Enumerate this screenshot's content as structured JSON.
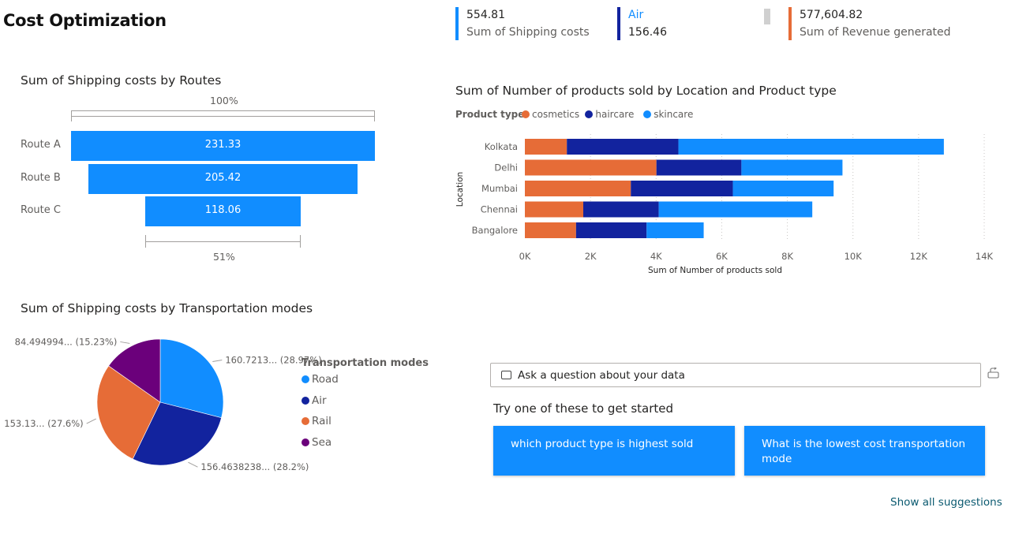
{
  "page": {
    "title": "Cost Optimization"
  },
  "kpis": [
    {
      "value": "554.81",
      "label": "Sum of Shipping costs",
      "color": "#118dff"
    },
    {
      "value": "156.46",
      "label": "Air",
      "color": "#12239e",
      "label_color": "#118dff"
    },
    {
      "value": "577,604.82",
      "label": "Sum of Revenue generated",
      "color": "#e66c37"
    }
  ],
  "funnel": {
    "title": "Sum of Shipping costs by Routes",
    "top_pct": "100%",
    "bottom_pct": "51%",
    "color": "#118dff",
    "chart_data": {
      "type": "bar",
      "categories": [
        "Route A",
        "Route B",
        "Route C"
      ],
      "values": [
        231.33,
        205.42,
        118.06
      ],
      "value_labels": [
        "231.33",
        "205.42",
        "118.06"
      ]
    }
  },
  "stacked": {
    "title": "Sum of Number of products sold by Location and Product type",
    "legend_title": "Product type",
    "xlabel": "Sum of Number of products sold",
    "ylabel": "Location",
    "chart_data": {
      "type": "bar",
      "orientation": "horizontal-stacked",
      "categories": [
        "Kolkata",
        "Delhi",
        "Mumbai",
        "Chennai",
        "Bangalore"
      ],
      "series": [
        {
          "name": "cosmetics",
          "color": "#e66c37",
          "values": [
            1280,
            4010,
            3230,
            1780,
            1560
          ]
        },
        {
          "name": "haircare",
          "color": "#12239e",
          "values": [
            3400,
            2590,
            3110,
            2300,
            2150
          ]
        },
        {
          "name": "skincare",
          "color": "#118dff",
          "values": [
            8090,
            3080,
            3070,
            4680,
            1740
          ]
        }
      ],
      "xlim": [
        0,
        14000
      ],
      "xticks": [
        "0K",
        "2K",
        "4K",
        "6K",
        "8K",
        "10K",
        "12K",
        "14K"
      ],
      "grid": true,
      "legend": "top-left"
    }
  },
  "pie": {
    "title": "Sum of Shipping costs by Transportation modes",
    "legend_title": "Transportation modes",
    "chart_data": {
      "type": "pie",
      "categories": [
        "Road",
        "Air",
        "Rail",
        "Sea"
      ],
      "values": [
        160.7213,
        156.4638238,
        153.13,
        84.494994
      ],
      "percentages": [
        28.97,
        28.2,
        27.6,
        15.23
      ],
      "labels": [
        "160.7213... (28.97%)",
        "156.4638238... (28.2%)",
        "153.13... (27.6%)",
        "84.494994... (15.23%)"
      ],
      "colors": [
        "#118dff",
        "#12239e",
        "#e66c37",
        "#6b007b"
      ],
      "legend": "right"
    }
  },
  "qa": {
    "placeholder": "Ask a question about your data",
    "try_text": "Try one of these to get started",
    "suggestions": [
      "which product type is highest sold",
      "What is the lowest cost transportation mode"
    ],
    "show_all": "Show all suggestions"
  }
}
